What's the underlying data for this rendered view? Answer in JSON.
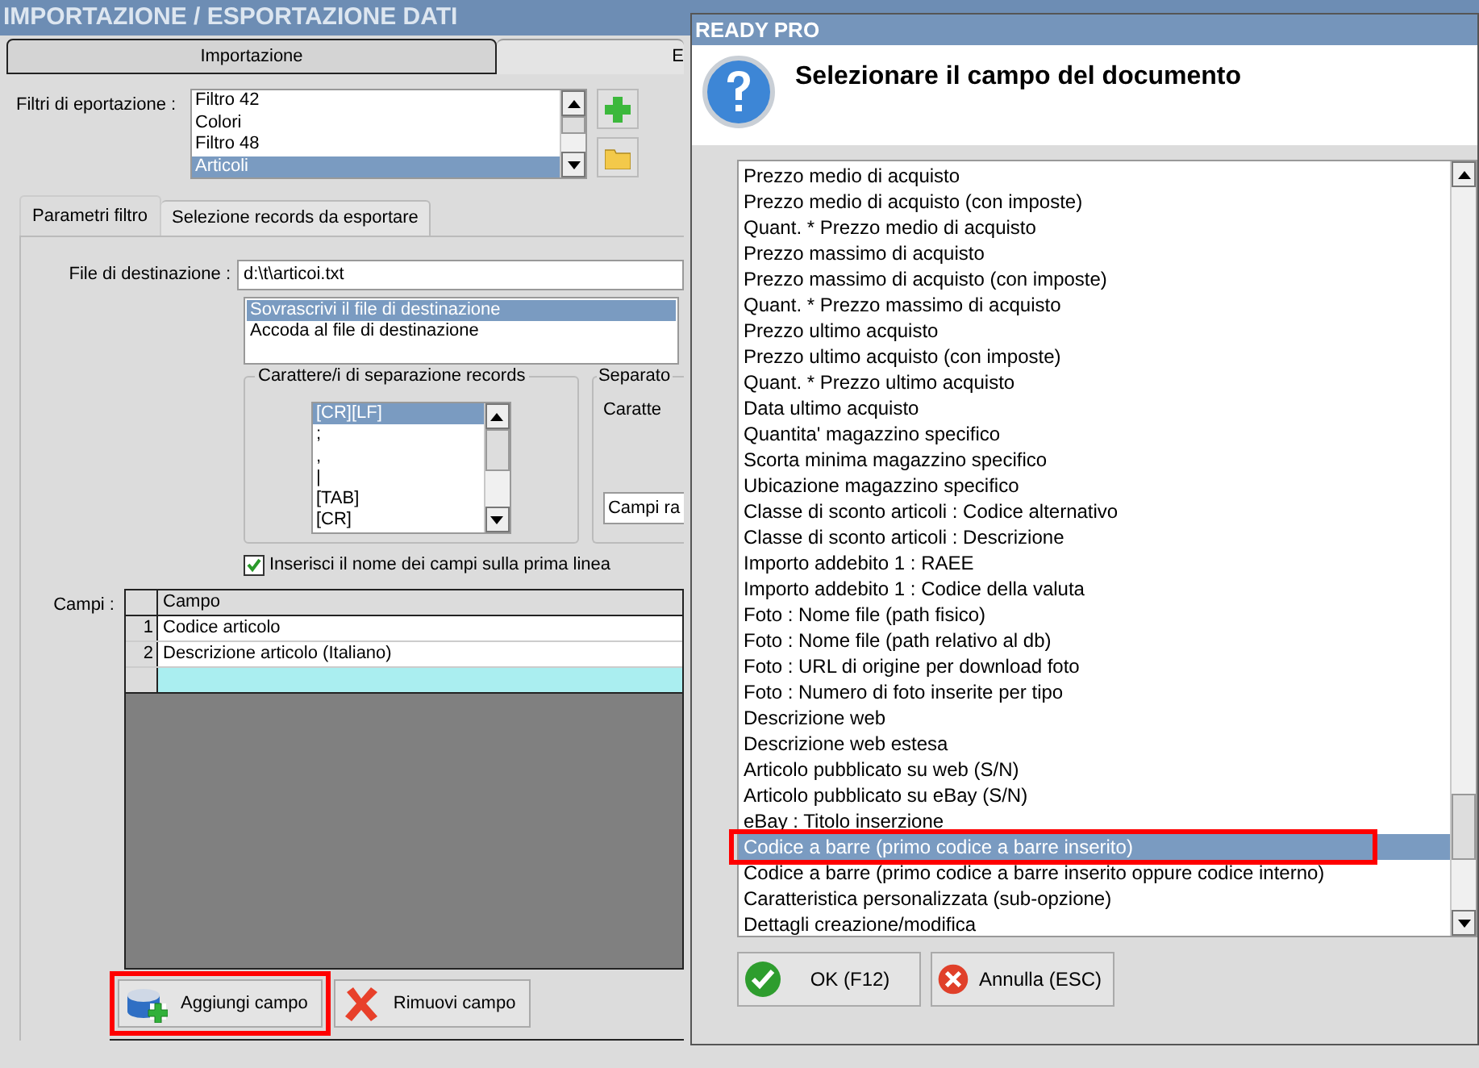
{
  "main_window": {
    "title": "IMPORTAZIONE / ESPORTAZIONE DATI",
    "tabs": [
      {
        "label": "Importazione",
        "selected": false
      },
      {
        "label": "E",
        "selected": true
      }
    ],
    "filters": {
      "label": "Filtri di eportazione :",
      "items": [
        {
          "label": "Filtro 42",
          "selected": false
        },
        {
          "label": "Colori",
          "selected": false
        },
        {
          "label": "Filtro 48",
          "selected": false
        },
        {
          "label": "Articoli",
          "selected": true
        }
      ]
    },
    "subtabs": [
      {
        "label": "Parametri filtro",
        "selected": true
      },
      {
        "label": "Selezione records da esportare",
        "selected": false
      }
    ],
    "destination": {
      "label": "File di destinazione :",
      "value": "d:\\t\\articoi.txt",
      "modes": [
        {
          "label": "Sovrascrivi il file di destinazione",
          "selected": true
        },
        {
          "label": "Accoda al file di destinazione",
          "selected": false
        }
      ]
    },
    "record_separator": {
      "title": "Carattere/i di separazione records",
      "items": [
        {
          "label": "[CR][LF]",
          "selected": true
        },
        {
          "label": ";",
          "selected": false
        },
        {
          "label": ",",
          "selected": false
        },
        {
          "label": "|",
          "selected": false
        },
        {
          "label": "[TAB]",
          "selected": false
        },
        {
          "label": "[CR]",
          "selected": false
        }
      ]
    },
    "field_separator": {
      "title": "Separato",
      "label": "Caratte",
      "value": "Campi ra"
    },
    "header_checkbox": {
      "label": "Inserisci il nome dei campi sulla prima linea",
      "checked": true
    },
    "fields": {
      "label": "Campi :",
      "columns": [
        "Campo"
      ],
      "rows": [
        {
          "number": "1",
          "name": "Codice articolo"
        },
        {
          "number": "2",
          "name": "Descrizione articolo (Italiano)"
        }
      ]
    },
    "buttons": [
      {
        "label": "Aggiungi campo",
        "kind": "add",
        "marked": true
      },
      {
        "label": "Rimuovi campo",
        "kind": "remove",
        "marked": false
      }
    ]
  },
  "dialog": {
    "title": "READY PRO",
    "heading": "Selezionare il campo del documento",
    "items": [
      {
        "label": "Prezzo medio di acquisto",
        "selected": false,
        "marked": false
      },
      {
        "label": "Prezzo medio di acquisto (con imposte)",
        "selected": false,
        "marked": false
      },
      {
        "label": "Quant. * Prezzo medio di acquisto",
        "selected": false,
        "marked": false
      },
      {
        "label": "Prezzo massimo di acquisto",
        "selected": false,
        "marked": false
      },
      {
        "label": "Prezzo massimo di acquisto (con imposte)",
        "selected": false,
        "marked": false
      },
      {
        "label": "Quant. * Prezzo massimo di acquisto",
        "selected": false,
        "marked": false
      },
      {
        "label": "Prezzo ultimo acquisto",
        "selected": false,
        "marked": false
      },
      {
        "label": "Prezzo ultimo acquisto (con imposte)",
        "selected": false,
        "marked": false
      },
      {
        "label": "Quant. * Prezzo ultimo acquisto",
        "selected": false,
        "marked": false
      },
      {
        "label": "Data ultimo acquisto",
        "selected": false,
        "marked": false
      },
      {
        "label": "Quantita' magazzino specifico",
        "selected": false,
        "marked": false
      },
      {
        "label": "Scorta minima magazzino specifico",
        "selected": false,
        "marked": false
      },
      {
        "label": "Ubicazione magazzino specifico",
        "selected": false,
        "marked": false
      },
      {
        "label": "Classe di sconto articoli : Codice alternativo",
        "selected": false,
        "marked": false
      },
      {
        "label": "Classe di sconto articoli : Descrizione",
        "selected": false,
        "marked": false
      },
      {
        "label": "Importo addebito 1 : RAEE",
        "selected": false,
        "marked": false
      },
      {
        "label": "Importo addebito 1 : Codice della valuta",
        "selected": false,
        "marked": false
      },
      {
        "label": "Foto : Nome file (path fisico)",
        "selected": false,
        "marked": false
      },
      {
        "label": "Foto : Nome file (path relativo al db)",
        "selected": false,
        "marked": false
      },
      {
        "label": "Foto : URL di origine per download foto",
        "selected": false,
        "marked": false
      },
      {
        "label": "Foto : Numero di foto inserite per tipo",
        "selected": false,
        "marked": false
      },
      {
        "label": "Descrizione web",
        "selected": false,
        "marked": false
      },
      {
        "label": "Descrizione web estesa",
        "selected": false,
        "marked": false
      },
      {
        "label": "Articolo pubblicato su web (S/N)",
        "selected": false,
        "marked": false
      },
      {
        "label": "Articolo pubblicato su eBay (S/N)",
        "selected": false,
        "marked": false
      },
      {
        "label": "eBay : Titolo inserzione",
        "selected": false,
        "marked": false
      },
      {
        "label": "Codice a barre (primo codice a barre inserito)",
        "selected": true,
        "marked": true
      },
      {
        "label": "Codice a barre (primo codice a barre inserito oppure codice interno)",
        "selected": false,
        "marked": false
      },
      {
        "label": "Caratteristica personalizzata (sub-opzione)",
        "selected": false,
        "marked": false
      },
      {
        "label": "Dettagli creazione/modifica",
        "selected": false,
        "marked": false
      }
    ],
    "buttons": [
      {
        "label": "OK (F12)",
        "kind": "ok"
      },
      {
        "label": "Annulla (ESC)",
        "kind": "cancel"
      }
    ]
  }
}
